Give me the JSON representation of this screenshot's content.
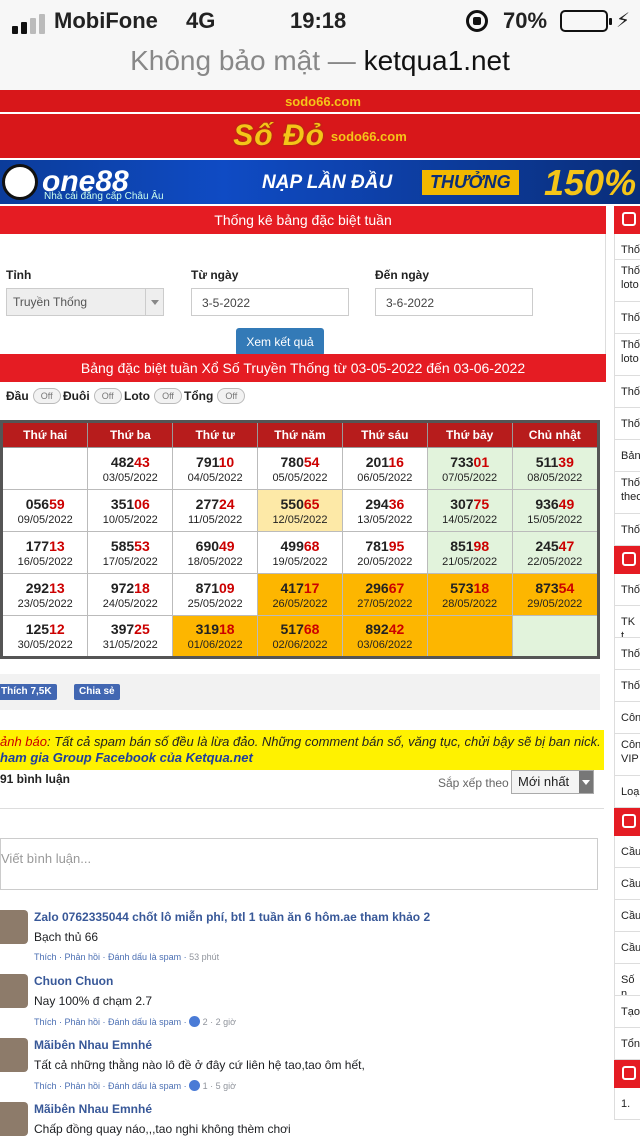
{
  "status": {
    "carrier": "MobiFone",
    "network": "4G",
    "time": "19:18",
    "battery": "70%"
  },
  "address": {
    "insecure": "Không bảo mật —",
    "domain": "ketqua1.net"
  },
  "banners": {
    "sodo_logo": "Số Đỏ",
    "sodo_sub": "sodo66.com",
    "one88_brand": "one88",
    "one88_tag": "Nhà cái đẳng cấp Châu Âu",
    "one88_promo": "NẠP LẦN ĐẦU",
    "one88_bonus": "THƯỞNG",
    "one88_pct": "150%"
  },
  "filter": {
    "title": "Thống kê bảng đặc biệt tuần",
    "province_label": "Tỉnh",
    "province_value": "Truyền Thống",
    "from_label": "Từ ngày",
    "from_value": "3-5-2022",
    "to_label": "Đến ngày",
    "to_value": "3-6-2022",
    "submit": "Xem kết quả"
  },
  "result": {
    "title": "Bảng đặc biệt tuần Xổ Số Truyền Thống từ 03-05-2022 đến 03-06-2022",
    "toggles": [
      {
        "label": "Đầu",
        "state": "Off"
      },
      {
        "label": "Đuôi",
        "state": "Off"
      },
      {
        "label": "Loto",
        "state": "Off"
      },
      {
        "label": "Tổng",
        "state": "Off"
      }
    ],
    "headers": [
      "Thứ hai",
      "Thứ ba",
      "Thứ tư",
      "Thứ năm",
      "Thứ sáu",
      "Thứ bảy",
      "Chủ nhật"
    ],
    "rows": [
      [
        {
          "a": "",
          "b": "",
          "date": "",
          "color": ""
        },
        {
          "a": "482",
          "b": "43",
          "date": "03/05/2022",
          "color": ""
        },
        {
          "a": "791",
          "b": "10",
          "date": "04/05/2022",
          "color": ""
        },
        {
          "a": "780",
          "b": "54",
          "date": "05/05/2022",
          "color": ""
        },
        {
          "a": "201",
          "b": "16",
          "date": "06/05/2022",
          "color": ""
        },
        {
          "a": "733",
          "b": "01",
          "date": "07/05/2022",
          "color": "green"
        },
        {
          "a": "511",
          "b": "39",
          "date": "08/05/2022",
          "color": "green"
        }
      ],
      [
        {
          "a": "056",
          "b": "59",
          "date": "09/05/2022",
          "color": ""
        },
        {
          "a": "351",
          "b": "06",
          "date": "10/05/2022",
          "color": ""
        },
        {
          "a": "277",
          "b": "24",
          "date": "11/05/2022",
          "color": ""
        },
        {
          "a": "550",
          "b": "65",
          "date": "12/05/2022",
          "color": "yellow"
        },
        {
          "a": "294",
          "b": "36",
          "date": "13/05/2022",
          "color": ""
        },
        {
          "a": "307",
          "b": "75",
          "date": "14/05/2022",
          "color": "green"
        },
        {
          "a": "936",
          "b": "49",
          "date": "15/05/2022",
          "color": "green"
        }
      ],
      [
        {
          "a": "177",
          "b": "13",
          "date": "16/05/2022",
          "color": ""
        },
        {
          "a": "585",
          "b": "53",
          "date": "17/05/2022",
          "color": ""
        },
        {
          "a": "690",
          "b": "49",
          "date": "18/05/2022",
          "color": ""
        },
        {
          "a": "499",
          "b": "68",
          "date": "19/05/2022",
          "color": ""
        },
        {
          "a": "781",
          "b": "95",
          "date": "20/05/2022",
          "color": ""
        },
        {
          "a": "851",
          "b": "98",
          "date": "21/05/2022",
          "color": "green"
        },
        {
          "a": "245",
          "b": "47",
          "date": "22/05/2022",
          "color": "green"
        }
      ],
      [
        {
          "a": "292",
          "b": "13",
          "date": "23/05/2022",
          "color": ""
        },
        {
          "a": "972",
          "b": "18",
          "date": "24/05/2022",
          "color": ""
        },
        {
          "a": "871",
          "b": "09",
          "date": "25/05/2022",
          "color": ""
        },
        {
          "a": "417",
          "b": "17",
          "date": "26/05/2022",
          "color": "orange"
        },
        {
          "a": "296",
          "b": "67",
          "date": "27/05/2022",
          "color": "orange"
        },
        {
          "a": "573",
          "b": "18",
          "date": "28/05/2022",
          "color": "orange"
        },
        {
          "a": "873",
          "b": "54",
          "date": "29/05/2022",
          "color": "orange"
        }
      ],
      [
        {
          "a": "125",
          "b": "12",
          "date": "30/05/2022",
          "color": ""
        },
        {
          "a": "397",
          "b": "25",
          "date": "31/05/2022",
          "color": ""
        },
        {
          "a": "319",
          "b": "18",
          "date": "01/06/2022",
          "color": "orange"
        },
        {
          "a": "517",
          "b": "68",
          "date": "02/06/2022",
          "color": "orange"
        },
        {
          "a": "892",
          "b": "42",
          "date": "03/06/2022",
          "color": "orange"
        },
        {
          "a": "",
          "b": "",
          "date": "",
          "color": "orange"
        },
        {
          "a": "",
          "b": "",
          "date": "",
          "color": "green"
        }
      ]
    ]
  },
  "facebook": {
    "like": "Thích 7,5K",
    "share": "Chia sẻ"
  },
  "notice": {
    "prefix": "ảnh báo",
    "text": ": Tất cả spam bán số đều là lừa đảo. Những comment bán số, văng tục, chửi bậy sẽ bị ban nick.",
    "join": "ham gia Group Facebook của Ketqua.net"
  },
  "comments_box": {
    "count": "91 bình luận",
    "sort_label": "Sắp xếp theo",
    "sort_value": "Mới nhất",
    "placeholder": "Viết bình luận..."
  },
  "comments": [
    {
      "name": "Zalo 0762335044 chốt lô miễn phí, btl 1 tuần ăn 6 hôm.ae tham khảo 2",
      "text": "Bạch thủ 66",
      "actions": "Thích · Phản hồi · Đánh dấu là spam ·",
      "likes": "",
      "time": "53 phút"
    },
    {
      "name": "Chuon Chuon",
      "text": "Nay 100% đ chạm 2.7",
      "actions": "Thích · Phản hồi · Đánh dấu là spam ·",
      "likes": "2",
      "time": "2 giờ"
    },
    {
      "name": "Mãibên Nhau Emnhé",
      "text": "Tất cả những thằng nào lô đề ở đây cứ liên hệ tao,tao ôm hết,",
      "actions": "Thích · Phản hồi · Đánh dấu là spam ·",
      "likes": "1",
      "time": "5 giờ"
    },
    {
      "name": "Mãibên Nhau Emnhé",
      "text": "Chấp đồng quay náo,,,tao nghi không thèm chơi",
      "actions": "",
      "likes": "",
      "time": ""
    }
  ],
  "sidebar": [
    "Thố",
    "Thố loto",
    "Thố",
    "Thố loto",
    "Thố",
    "Thố",
    "Bản",
    "Thố theo",
    "Thố",
    "Thố",
    "TK t",
    "Thố",
    "Thố",
    "Côn",
    "Côn VIP",
    "Loại",
    "Cầu",
    "Cầu",
    "Cầu",
    "Cầu",
    "Số n",
    "Tạo",
    "Tổn",
    "1."
  ],
  "colors": {
    "red": "#e51c23",
    "green_cell": "#e2f3dc",
    "yellow_cell": "#fde9a7",
    "orange_cell": "#fdb600",
    "button": "#337ab7"
  }
}
